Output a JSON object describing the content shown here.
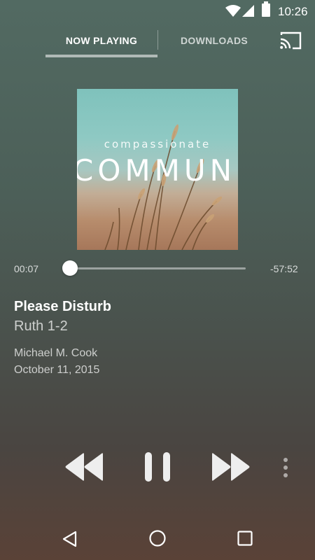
{
  "status_bar": {
    "time": "10:26",
    "icons": [
      "wifi-icon",
      "cell-signal-icon",
      "battery-icon"
    ]
  },
  "tabs": [
    {
      "label": "NOW PLAYING",
      "active": true
    },
    {
      "label": "DOWNLOADS",
      "active": false
    }
  ],
  "cast_icon": "cast-icon",
  "album_art": {
    "subtitle": "compassionate",
    "title": "COMMUNITY"
  },
  "player": {
    "elapsed": "00:07",
    "remaining": "-57:52",
    "progress_fraction": 0.002
  },
  "track": {
    "title": "Please Disturb",
    "subtitle": "Ruth 1-2",
    "speaker": "Michael M. Cook",
    "date": "October 11, 2015"
  },
  "controls": [
    "rewind-icon",
    "pause-icon",
    "fast-forward-icon",
    "more-vert-icon"
  ],
  "nav": [
    "back-icon",
    "home-icon",
    "recents-icon"
  ],
  "colors": {
    "accent": "#ffffff",
    "background_top": "#526a62",
    "background_bottom": "#5a4237"
  }
}
